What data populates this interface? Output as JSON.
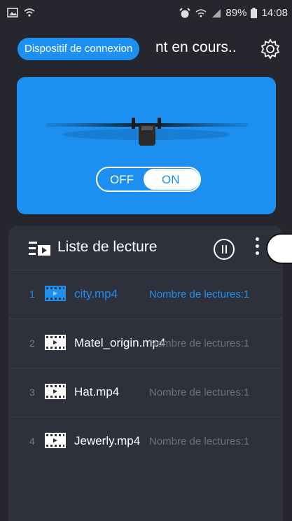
{
  "status_bar": {
    "battery": "89%",
    "time": "14:08"
  },
  "header": {
    "connection_button": "Dispositif de connexion",
    "title": "nt en cours.."
  },
  "device": {
    "toggle": {
      "off_label": "OFF",
      "on_label": "ON",
      "state": "on"
    }
  },
  "playlist": {
    "title": "Liste de lecture",
    "items": [
      {
        "index": "1",
        "name": "city.mp4",
        "plays": "Nombre de lectures:1",
        "active": true
      },
      {
        "index": "2",
        "name": "Matel_origin.mp4",
        "plays": "Nombre de lectures:1",
        "active": false
      },
      {
        "index": "3",
        "name": "Hat.mp4",
        "plays": "Nombre de lectures:1",
        "active": false
      },
      {
        "index": "4",
        "name": "Jewerly.mp4",
        "plays": "Nombre de lectures:1",
        "active": false
      }
    ]
  },
  "colors": {
    "accent": "#1e90f0",
    "background": "#25262e",
    "card": "#2e303b"
  }
}
